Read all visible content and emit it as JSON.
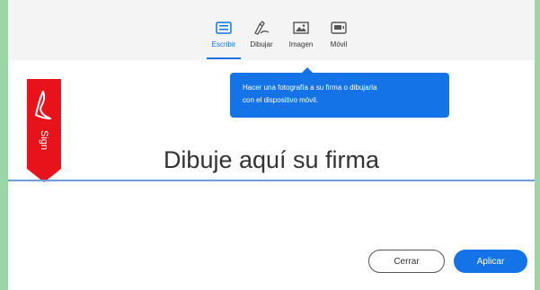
{
  "tabs": [
    {
      "id": "type",
      "label": "Escribir",
      "icon": "keyboard-icon",
      "active": true
    },
    {
      "id": "draw",
      "label": "Dibujar",
      "icon": "pen-icon",
      "active": false
    },
    {
      "id": "image",
      "label": "Imagen",
      "icon": "image-icon",
      "active": false
    },
    {
      "id": "mobile",
      "label": "Móvil",
      "icon": "mobile-icon",
      "active": false
    }
  ],
  "tooltip": {
    "line1": "Hacer una fotografía a su firma o dibujarla",
    "line2": "con el dispositivo móvil."
  },
  "ribbon": {
    "label": "Sign",
    "color": "#e8131a",
    "icon": "acrobat-logo-icon"
  },
  "sign_area": {
    "placeholder": "Dibuje aquí su firma"
  },
  "buttons": {
    "cancel": "Cerrar",
    "apply": "Aplicar"
  },
  "colors": {
    "accent": "#1473e6",
    "background": "#9ad6a6",
    "ribbon": "#e8131a"
  }
}
